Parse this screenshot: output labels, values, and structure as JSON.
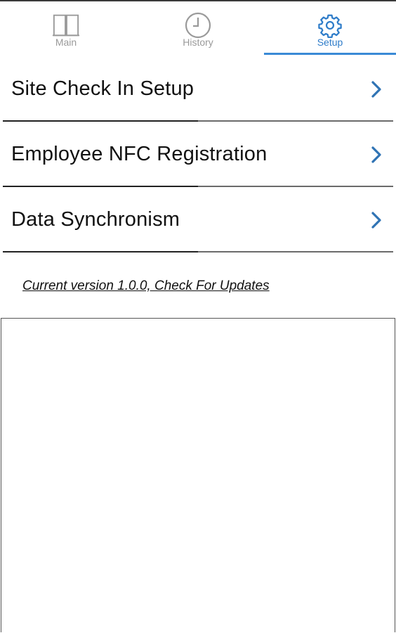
{
  "tabs": [
    {
      "label": "Main",
      "icon": "book-icon",
      "active": false
    },
    {
      "label": "History",
      "icon": "clock-icon",
      "active": false
    },
    {
      "label": "Setup",
      "icon": "gear-icon",
      "active": true
    }
  ],
  "menu": {
    "items": [
      {
        "label": "Site Check In Setup",
        "icon": "chevron-right-icon"
      },
      {
        "label": "Employee NFC Registration",
        "icon": "chevron-right-icon"
      },
      {
        "label": "Data Synchronism",
        "icon": "chevron-right-icon"
      }
    ]
  },
  "version": {
    "text": "Current version 1.0.0,  Check For Updates"
  },
  "colors": {
    "accent": "#2e7cc9",
    "inactive": "#9a9a9a",
    "chevron": "#2f73b4"
  }
}
